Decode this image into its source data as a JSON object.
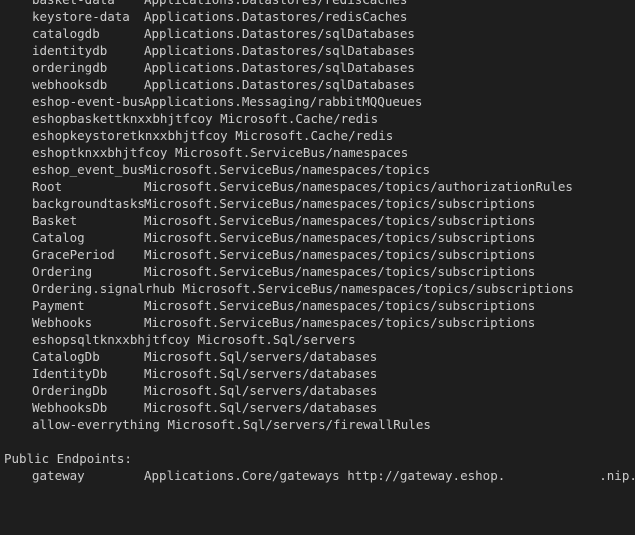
{
  "resources": [
    {
      "name": "basket-data",
      "type": "Applications.Datastores/redisCaches"
    },
    {
      "name": "keystore-data",
      "type": "Applications.Datastores/redisCaches"
    },
    {
      "name": "catalogdb",
      "type": "Applications.Datastores/sqlDatabases"
    },
    {
      "name": "identitydb",
      "type": "Applications.Datastores/sqlDatabases"
    },
    {
      "name": "orderingdb",
      "type": "Applications.Datastores/sqlDatabases"
    },
    {
      "name": "webhooksdb",
      "type": "Applications.Datastores/sqlDatabases"
    },
    {
      "name": "eshop-event-bus",
      "type": "Applications.Messaging/rabbitMQQueues"
    },
    {
      "name": "eshopbaskettknxxbhjtfcoy",
      "type": "Microsoft.Cache/redis",
      "inline": true
    },
    {
      "name": "eshopkeystoretknxxbhjtfcoy",
      "type": "Microsoft.Cache/redis",
      "inline": true
    },
    {
      "name": "eshoptknxxbhjtfcoy",
      "type": "Microsoft.ServiceBus/namespaces",
      "inline": true
    },
    {
      "name": "eshop_event_bus",
      "type": "Microsoft.ServiceBus/namespaces/topics"
    },
    {
      "name": "Root",
      "type": "Microsoft.ServiceBus/namespaces/topics/authorizationRules"
    },
    {
      "name": "backgroundtasks",
      "type": "Microsoft.ServiceBus/namespaces/topics/subscriptions"
    },
    {
      "name": "Basket",
      "type": "Microsoft.ServiceBus/namespaces/topics/subscriptions"
    },
    {
      "name": "Catalog",
      "type": "Microsoft.ServiceBus/namespaces/topics/subscriptions"
    },
    {
      "name": "GracePeriod",
      "type": "Microsoft.ServiceBus/namespaces/topics/subscriptions"
    },
    {
      "name": "Ordering",
      "type": "Microsoft.ServiceBus/namespaces/topics/subscriptions"
    },
    {
      "name": "Ordering.signalrhub",
      "type": "Microsoft.ServiceBus/namespaces/topics/subscriptions",
      "inline": true
    },
    {
      "name": "Payment",
      "type": "Microsoft.ServiceBus/namespaces/topics/subscriptions"
    },
    {
      "name": "Webhooks",
      "type": "Microsoft.ServiceBus/namespaces/topics/subscriptions"
    },
    {
      "name": "eshopsqltknxxbhjtfcoy",
      "type": "Microsoft.Sql/servers",
      "inline": true
    },
    {
      "name": "CatalogDb",
      "type": "Microsoft.Sql/servers/databases"
    },
    {
      "name": "IdentityDb",
      "type": "Microsoft.Sql/servers/databases"
    },
    {
      "name": "OrderingDb",
      "type": "Microsoft.Sql/servers/databases"
    },
    {
      "name": "WebhooksDb",
      "type": "Microsoft.Sql/servers/databases"
    },
    {
      "name": "allow-everrything",
      "type": "Microsoft.Sql/servers/firewallRules",
      "inline": true
    }
  ],
  "endpoints_heading": "Public Endpoints:",
  "endpoint": {
    "name": "gateway",
    "type": "Applications.Core/gateways",
    "url_start": "http://gateway.eshop.",
    "url_end": ".nip.io"
  }
}
